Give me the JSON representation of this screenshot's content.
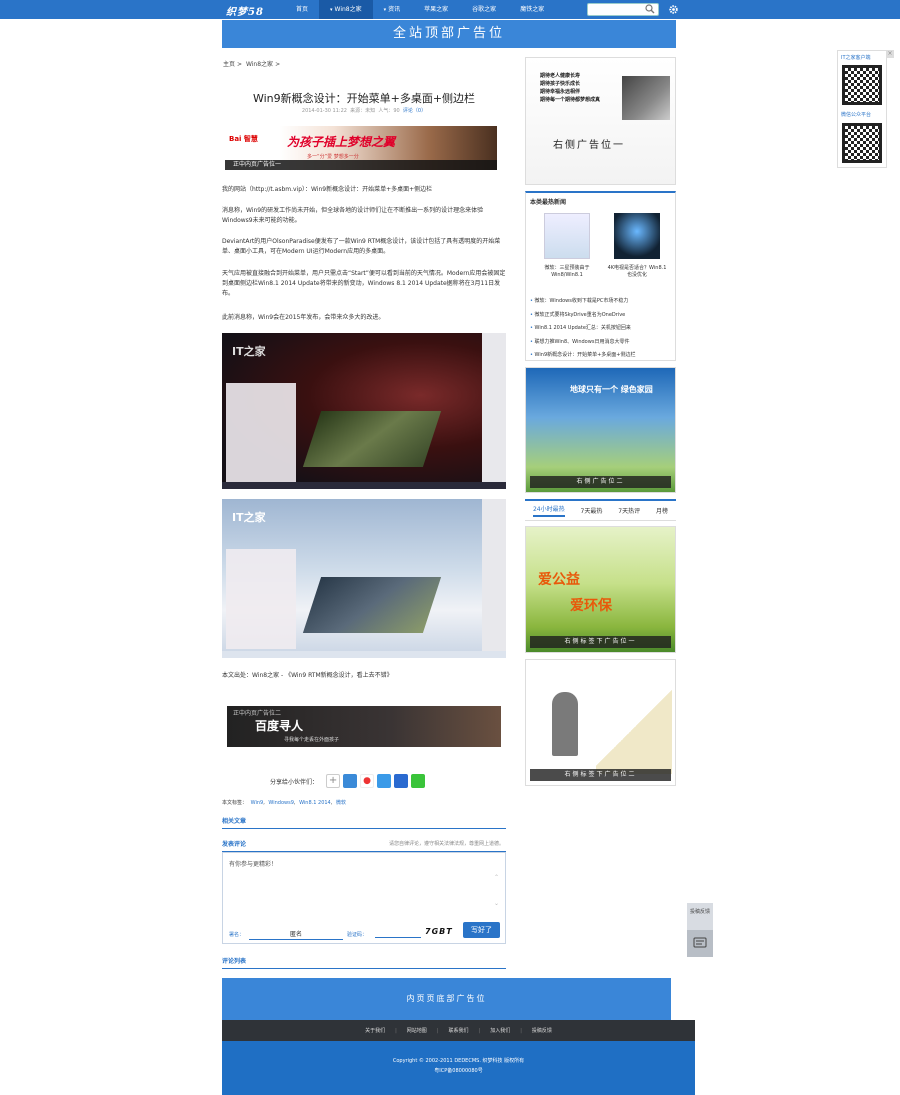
{
  "header": {
    "logo": "织梦58",
    "nav": [
      {
        "label": "首页",
        "arrow": ""
      },
      {
        "label": "Win8之家",
        "arrow": "▾"
      },
      {
        "label": "资讯",
        "arrow": "▾"
      },
      {
        "label": "苹果之家",
        "arrow": ""
      },
      {
        "label": "谷歌之家",
        "arrow": ""
      },
      {
        "label": "魔铁之家",
        "arrow": ""
      }
    ],
    "active_index": 1,
    "search_placeholder": "",
    "accent": "#2a74c8"
  },
  "top_banner": "全站顶部广告位",
  "breadcrumb": [
    "主页",
    "Win8之家"
  ],
  "article": {
    "title": "Win9新概念设计：开始菜单+多桌面+侧边栏",
    "meta_date": "2014-01-30 11:22",
    "meta_source": "来源：未知",
    "meta_views": "人气：90",
    "meta_comment": "评论（0）",
    "ad_top": {
      "brand": "Bai 智慧",
      "slogan": "为孩子插上梦想之翼",
      "sub": "多一“分”爱 梦想多一分",
      "caption": "正中内页广告位一"
    },
    "paragraphs": [
      "我的网站（http://t.asbm.vip）：Win9新概念设计：开始菜单+多桌面+侧边栏",
      "消息称，Win9的研发工作尚未开始，但全球各地的设计师们让在不断推出一系列的设计理念来体验Windows9未来可能的功能。",
      "DeviantArt的用户OlsonParadise便发布了一款Win9 RTM概念设计，该设计包括了具有透明度的开始菜单、桌面小工具，可在Modern UI运行Modern应用的多桌面。",
      "天气应用被直接融合到开始菜单，用户只需点击“Start”便可以看到当前的天气情况。Modern应用会被固定到桌面侧边栏Win8.1 2014 Update将带来的新变动，Windows 8.1 2014 Update据称将在3月11日发布。",
      "此前消息称，Win9会在2015年发布，会带来众多大的改进。"
    ],
    "screenshot_logo": "IT之家",
    "source_line": "本文出处：Win8之家 - 《Win9 RTM新概念设计，看上去不错》",
    "ad_mid": {
      "label": "正中内页广告位二",
      "title": "百度寻人",
      "sub": "寻我每个走丢在外面孩子"
    },
    "share_label": "分享给小伙伴们：",
    "tags_label": "本文标签：",
    "tags": [
      "Win9",
      "Windows9",
      "Win8.1 2014",
      "微软"
    ],
    "related_title": "相关文章",
    "comment_title": "发表评论",
    "comment_notice": "请您自律评论，遵守相关法律法规，尊重网上道德。",
    "comment_placeholder": "有你参与更精彩！",
    "name_label": "署名：",
    "name_value": "匿名",
    "code_label": "验证码：",
    "captcha": "7GBT",
    "submit": "写好了",
    "list_title": "评论列表"
  },
  "sidebar": {
    "ad1": {
      "lines": [
        "期待老人健康长寿",
        "期待孩子快乐成长",
        "期待幸福永远相伴",
        "期待每一个期待都梦想成真"
      ],
      "caption": "右侧广告位一"
    },
    "hot": {
      "title": "本类最热新闻",
      "thumbs": [
        "微软：三星预装由于Win8/Win8.1",
        "4K电视是否适合？Win8.1也没优化"
      ],
      "list": [
        "微软：Windows收到下载是PC市场不稳力",
        "微软正式要将SkyDrive重名为OneDrive",
        "Win8.1 2014 Update汇总：关机按钮回来",
        "联想力推Win8、Windows日用消息大零件",
        "Win9新概念设计：开始菜单+多桌面+侧边栏"
      ]
    },
    "ad2": {
      "text": "地球只有一个 绿色家园",
      "caption": "右侧广告位二"
    },
    "tabs": [
      "24小时最热",
      "7天最热",
      "7天热评",
      "月榜"
    ],
    "active_tab": 0,
    "ad3": {
      "t1": "爱公益",
      "t2": "爱环保",
      "caption": "右侧标签下广告位一"
    },
    "ad4": {
      "caption": "右侧标签下广告位二"
    }
  },
  "qr": {
    "t1": "IT之家客户端",
    "t2": "微信公众平台"
  },
  "feedback": {
    "label": "投稿反馈"
  },
  "footer": {
    "ad": "内页页底部广告位",
    "links": [
      "关于我们",
      "网站地图",
      "联系我们",
      "加入我们",
      "投稿反馈"
    ],
    "copyright": "Copyright © 2002-2011 DEDECMS. 织梦科技 版权所有",
    "icp": "粤ICP备08000080号"
  }
}
